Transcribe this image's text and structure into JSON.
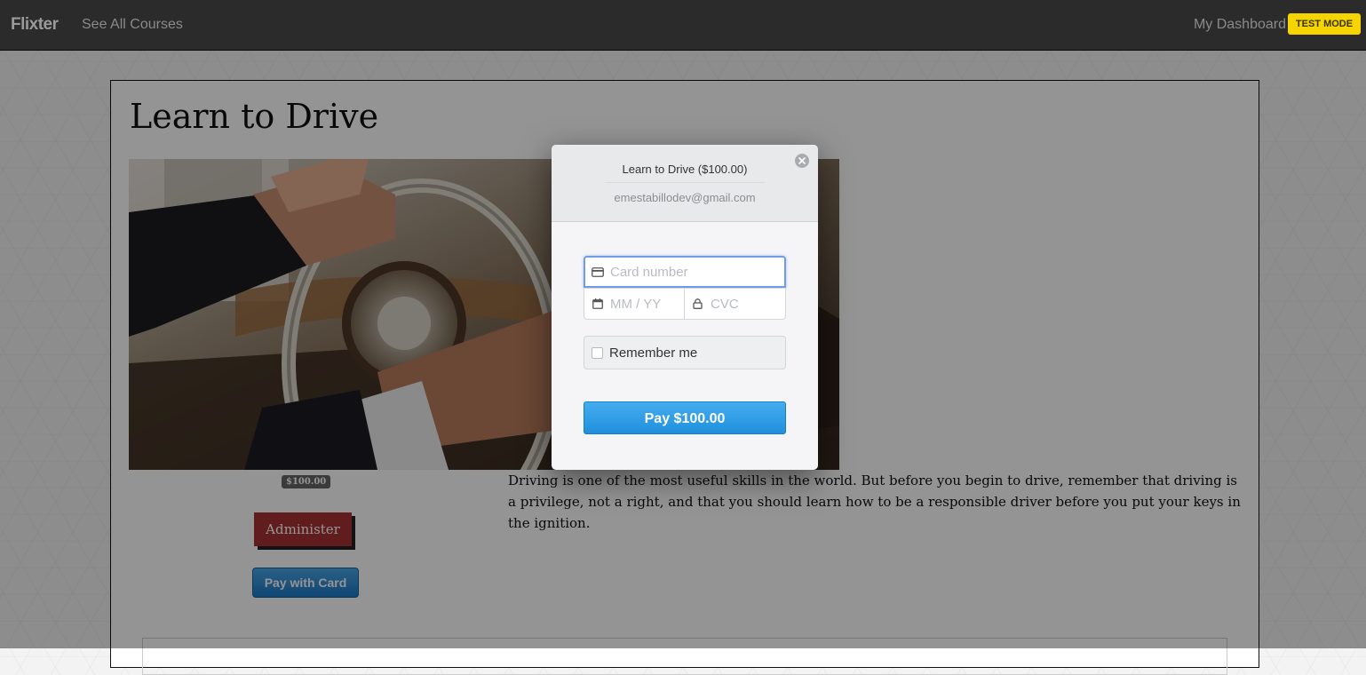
{
  "navbar": {
    "brand": "Flixter",
    "see_all_courses": "See All Courses",
    "my_dashboard": "My Dashboard",
    "test_mode": "TEST MODE"
  },
  "course": {
    "title": "Learn to Drive",
    "image_icon": "car-steering-wheel-photo",
    "price": "$100.00",
    "administer_label": "Administer",
    "pay_with_card_label": "Pay with Card",
    "description": "Driving is one of the most useful skills in the world. But before you begin to drive, remember that driving is a privilege, not a right, and that you should learn how to be a responsible driver before you put your keys in the ignition."
  },
  "checkout": {
    "title": "Learn to Drive ($100.00)",
    "email": "emestabillodev@gmail.com",
    "close_icon": "close-icon",
    "card_number_placeholder": "Card number",
    "expiry_placeholder": "MM / YY",
    "cvc_placeholder": "CVC",
    "remember_me": "Remember me",
    "pay_button": "Pay $100.00"
  },
  "colors": {
    "navbar_bg": "#2b2b2b",
    "test_mode_bg": "#f5d400",
    "administer_bg": "#a83232",
    "pay_button_bg": "#2196e3"
  }
}
